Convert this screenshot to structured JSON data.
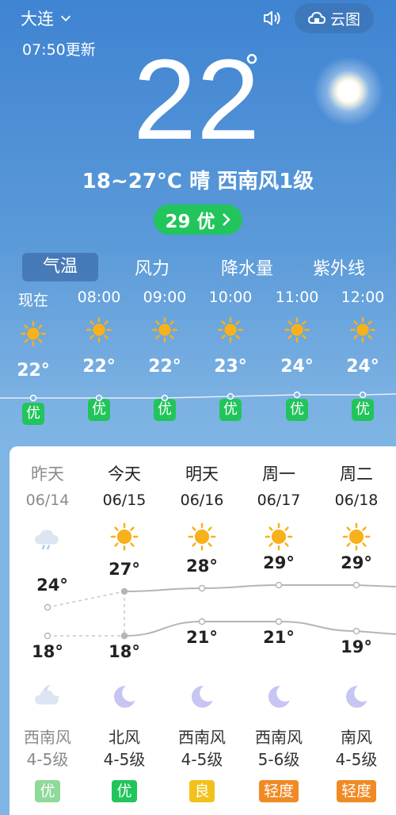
{
  "header": {
    "city": "大连",
    "update_time": "07:50更新",
    "cloud_map_label": "云图"
  },
  "current": {
    "temperature": "22",
    "degree": "°",
    "summary": "18~27°C 晴 西南风1级",
    "aqi_label": "29 优"
  },
  "tabs": [
    {
      "label": "气温",
      "active": true
    },
    {
      "label": "风力",
      "active": false
    },
    {
      "label": "降水量",
      "active": false
    },
    {
      "label": "紫外线",
      "active": false
    }
  ],
  "hourly": [
    {
      "time": "现在",
      "temp": "22°",
      "aqi": "优",
      "value": 22
    },
    {
      "time": "08:00",
      "temp": "22°",
      "aqi": "优",
      "value": 22
    },
    {
      "time": "09:00",
      "temp": "22°",
      "aqi": "优",
      "value": 22
    },
    {
      "time": "10:00",
      "temp": "23°",
      "aqi": "优",
      "value": 23
    },
    {
      "time": "11:00",
      "temp": "24°",
      "aqi": "优",
      "value": 24
    },
    {
      "time": "12:00",
      "temp": "24°",
      "aqi": "优",
      "value": 24
    }
  ],
  "daily": [
    {
      "name": "昨天",
      "date": "06/14",
      "high": "24°",
      "low": "18°",
      "high_v": 24,
      "low_v": 18,
      "icon": "cloudy-icon",
      "night_icon": "cloudy-moon-icon",
      "wind": "西南风",
      "wind_level": "4-5级",
      "aqi": "优",
      "aqi_color": "#8fd99a",
      "past": true
    },
    {
      "name": "今天",
      "date": "06/15",
      "high": "27°",
      "low": "18°",
      "high_v": 27,
      "low_v": 18,
      "icon": "sun-icon",
      "night_icon": "moon-icon",
      "wind": "北风",
      "wind_level": "4-5级",
      "aqi": "优",
      "aqi_color": "#21c55b",
      "past": false
    },
    {
      "name": "明天",
      "date": "06/16",
      "high": "28°",
      "low": "21°",
      "high_v": 28,
      "low_v": 21,
      "icon": "sun-icon",
      "night_icon": "moon-icon",
      "wind": "西南风",
      "wind_level": "4-5级",
      "aqi": "良",
      "aqi_color": "#f2c21b",
      "past": false
    },
    {
      "name": "周一",
      "date": "06/17",
      "high": "29°",
      "low": "21°",
      "high_v": 29,
      "low_v": 21,
      "icon": "sun-icon",
      "night_icon": "moon-icon",
      "wind": "西南风",
      "wind_level": "5-6级",
      "aqi": "轻度",
      "aqi_color": "#f08a24",
      "past": false
    },
    {
      "name": "周二",
      "date": "06/18",
      "high": "29°",
      "low": "19°",
      "high_v": 29,
      "low_v": 19,
      "icon": "sun-icon",
      "night_icon": "moon-icon",
      "wind": "南风",
      "wind_level": "4-5级",
      "aqi": "轻度",
      "aqi_color": "#f08a24",
      "past": false
    }
  ],
  "colors": {
    "aqi_good": "#21c55b",
    "sun": "#f7b11b"
  }
}
